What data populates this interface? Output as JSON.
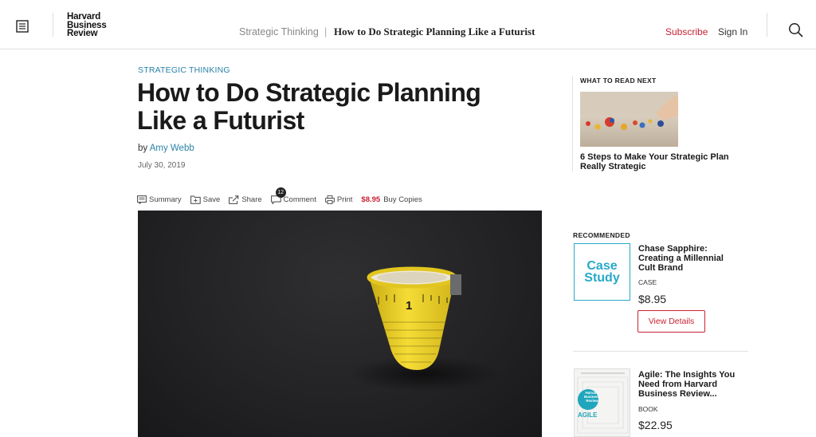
{
  "header": {
    "logo_lines": [
      "Harvard",
      "Business",
      "Review"
    ],
    "breadcrumb_topic": "Strategic Thinking",
    "breadcrumb_separator": "|",
    "breadcrumb_title": "How to Do Strategic Planning Like a Futurist",
    "subscribe_label": "Subscribe",
    "signin_label": "Sign In",
    "menu_icon": "menu-icon",
    "search_icon": "search-icon"
  },
  "article": {
    "kicker": "STRATEGIC THINKING",
    "title": "How to Do Strategic Planning Like a Futurist",
    "byline_prefix": "by",
    "author": "Amy Webb",
    "date": "July 30, 2019",
    "tools": {
      "summary": "Summary",
      "save": "Save",
      "share": "Share",
      "comment": "Comment",
      "comment_count": "12",
      "print": "Print",
      "price": "$8.95",
      "buy": "Buy Copies"
    },
    "hero_tape_number": "1"
  },
  "sidebar": {
    "what_to_read_label": "WHAT TO READ NEXT",
    "what_to_read_title": "6 Steps to Make Your Strategic Plan Really Strategic",
    "recommended_label": "RECOMMENDED",
    "products": [
      {
        "tile_lines": [
          "Case",
          "Study"
        ],
        "title": "Chase Sapphire: Creating a Millennial Cult Brand",
        "type": "CASE",
        "price": "$8.95",
        "cta": "View Details"
      },
      {
        "tile_logo_lines": [
          "Harvard",
          "Business",
          "Review"
        ],
        "tile_word": "AGILE",
        "title": "Agile: The Insights You Need from Harvard Business Review...",
        "type": "BOOK",
        "price": "$22.95"
      }
    ]
  },
  "colors": {
    "accent_red": "#c82333",
    "link_blue": "#2a82a8",
    "case_cyan": "#27a9c9",
    "tape_yellow": "#f2d52a"
  }
}
